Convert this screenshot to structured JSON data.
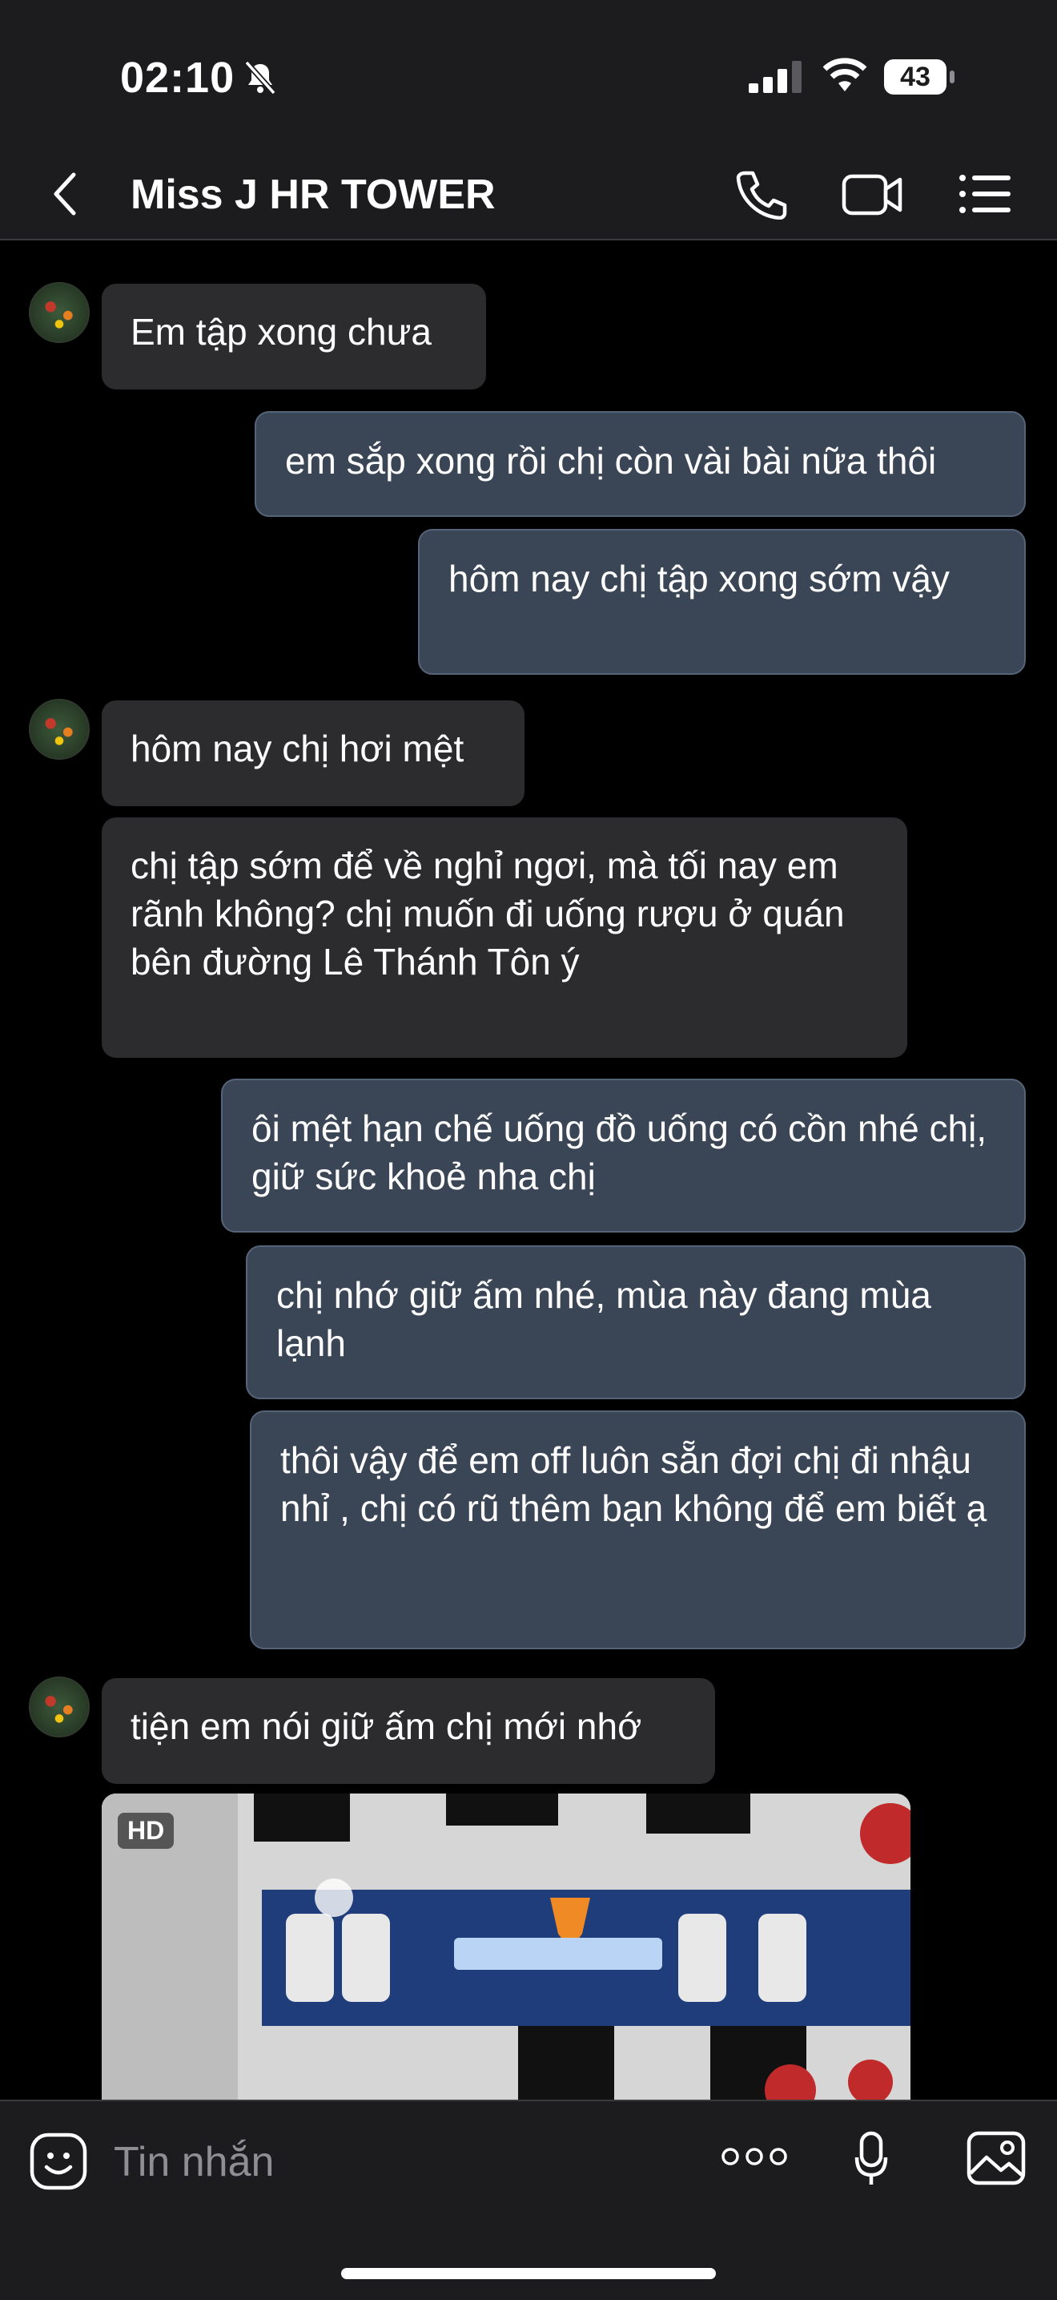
{
  "status": {
    "time": "02:10",
    "battery": "43"
  },
  "header": {
    "title": "Miss J HR TOWER"
  },
  "messages": [
    {
      "dir": "in",
      "text": "Em tập xong chưa"
    },
    {
      "dir": "out",
      "text": "em sắp xong rồi chị còn vài bài nữa thôi"
    },
    {
      "dir": "out",
      "text": "hôm nay chị tập xong sớm vậy"
    },
    {
      "dir": "in",
      "text": "hôm nay chị hơi mệt"
    },
    {
      "dir": "in",
      "text": "chị tập sớm để về nghỉ ngơi, mà tối nay em rãnh không? chị muốn đi uống rượu ở quán bên đường Lê Thánh Tôn ý"
    },
    {
      "dir": "out",
      "text": "ôi mệt hạn chế uống đồ uống có cồn nhé chị, giữ sức khoẻ nha chị"
    },
    {
      "dir": "out",
      "text": "chị nhớ giữ ấm nhé, mùa này đang mùa lạnh"
    },
    {
      "dir": "out",
      "text": "thôi vậy để em off luôn sẵn đợi chị đi nhậu nhỉ , chị có rũ thêm bạn không để em biết ạ"
    },
    {
      "dir": "in",
      "text": "tiện em nói giữ ấm chị mới nhớ"
    }
  ],
  "media": {
    "badge": "HD"
  },
  "composer": {
    "placeholder": "Tin nhắn"
  },
  "icons": {
    "back": "chevron-left-icon",
    "call": "phone-icon",
    "video": "video-camera-icon",
    "menu": "list-menu-icon",
    "emoji": "emoji-icon",
    "more": "more-dots-icon",
    "mic": "microphone-icon",
    "photo": "image-icon"
  },
  "colors": {
    "incoming": "#2c2c2e",
    "outgoing": "#3a4556",
    "background": "#000000"
  }
}
